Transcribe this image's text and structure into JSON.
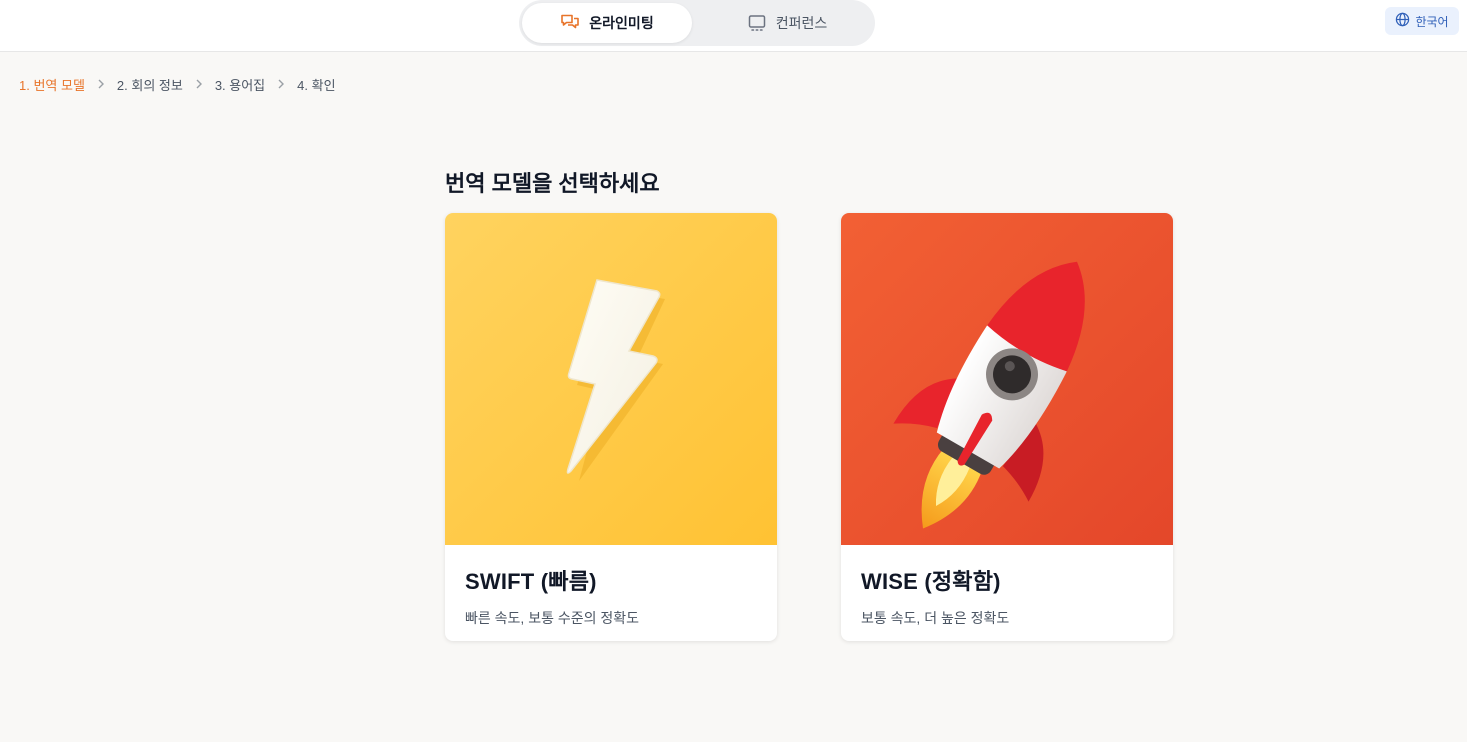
{
  "header": {
    "tabs": [
      {
        "label": "온라인미팅",
        "active": true,
        "icon": "chat-bubbles-icon"
      },
      {
        "label": "컨퍼런스",
        "active": false,
        "icon": "monitor-icon"
      }
    ],
    "language": {
      "label": "한국어",
      "icon": "globe-icon"
    }
  },
  "breadcrumb": {
    "steps": [
      {
        "label": "1. 번역 모델",
        "active": true
      },
      {
        "label": "2. 회의 정보",
        "active": false
      },
      {
        "label": "3. 용어집",
        "active": false
      },
      {
        "label": "4. 확인",
        "active": false
      }
    ]
  },
  "main": {
    "title": "번역 모델을 선택하세요",
    "cards": [
      {
        "title": "SWIFT (빠름)",
        "description": "빠른 속도, 보통 수준의 정확도",
        "image": "lightning-bolt-illustration"
      },
      {
        "title": "WISE (정확함)",
        "description": "보통 속도, 더 높은 정확도",
        "image": "rocket-illustration"
      }
    ]
  },
  "colors": {
    "accent": "#e8742a",
    "swift_bg": "#ffc93c",
    "wise_bg": "#ec5a32",
    "language_button": "#eaf1fd"
  }
}
